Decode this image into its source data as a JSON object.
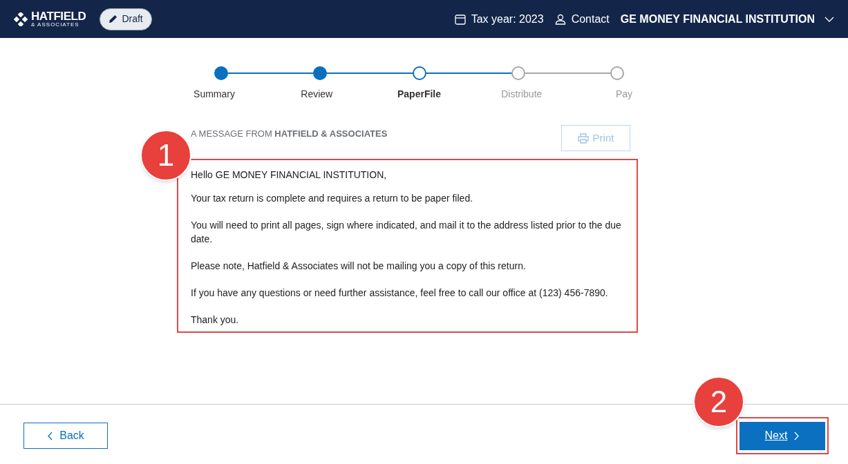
{
  "header": {
    "logo": {
      "name": "HATFIELD",
      "tagline": "& ASSOCIATES"
    },
    "status_badge": "Draft",
    "tax_year": "Tax year: 2023",
    "contact": "Contact",
    "account": "GE MONEY FINANCIAL INSTITUTION"
  },
  "steps": [
    {
      "label": "Summary",
      "completed": true,
      "selected": false
    },
    {
      "label": "Review",
      "completed": true,
      "selected": false
    },
    {
      "label": "PaperFile",
      "completed": false,
      "selected": true
    },
    {
      "label": "Distribute",
      "completed": false,
      "selected": false
    },
    {
      "label": "Pay",
      "completed": false,
      "selected": false
    }
  ],
  "message": {
    "heading": "A MESSAGE FROM **HATFIELD & ASSOCIATES**",
    "print_button": {
      "label": "Print",
      "disabled": true
    },
    "greeting": "Hello GE MONEY FINANCIAL INSTITUTION,",
    "paragraphs": [
      "Your tax return is complete and requires a return to be paper filed.",
      "You will need to print all pages, sign where indicated, and mail it to the address listed prior to the due date.",
      "Please note, Hatfield & Associates will not be mailing you a copy of this return.",
      "If you have any questions or need further assistance, feel free to call our office at (123) 456-7890.",
      "Thank you."
    ]
  },
  "footer": {
    "back_button": "Back",
    "next_button": "Next"
  },
  "annotations": [
    {
      "label": "1"
    },
    {
      "label": "2"
    }
  ]
}
